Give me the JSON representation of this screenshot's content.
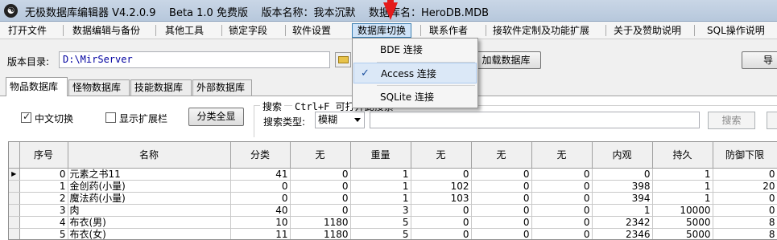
{
  "window": {
    "title": "无极数据库编辑器 V4.2.0.9    Beta 1.0 免费版    版本名称：我本沉默    数据库名：HeroDB.MDB"
  },
  "menu": [
    {
      "id": "open-file",
      "label": "打开文件"
    },
    {
      "id": "db-edit",
      "label": "数据编辑与备份"
    },
    {
      "id": "other-tools",
      "label": "其他工具"
    },
    {
      "id": "lock-field",
      "label": "锁定字段"
    },
    {
      "id": "settings",
      "label": "软件设置"
    },
    {
      "id": "db-switch",
      "label": "数据库切换"
    },
    {
      "id": "contact",
      "label": "联系作者"
    },
    {
      "id": "custom",
      "label": "接软件定制及功能扩展"
    },
    {
      "id": "about",
      "label": "关于及赞助说明"
    },
    {
      "id": "sql",
      "label": "SQL操作说明"
    }
  ],
  "dropdown": {
    "items": [
      {
        "label": "BDE 连接",
        "checked": false
      },
      {
        "label": "Access 连接",
        "checked": true
      },
      {
        "label": "SQLite 连接",
        "checked": false
      }
    ],
    "check_glyph": "✓"
  },
  "dir": {
    "label": "版本目录:",
    "value": "D:\\MirServer",
    "load_button": "加载数据库",
    "import_button": "导入"
  },
  "tabs": [
    {
      "label": "物品数据库",
      "active": true
    },
    {
      "label": "怪物数据库",
      "active": false
    },
    {
      "label": "技能数据库",
      "active": false
    },
    {
      "label": "外部数据库",
      "active": false
    }
  ],
  "options": {
    "chinese_switch": {
      "label": "中文切换",
      "checked": true
    },
    "show_ext": {
      "label": "显示扩展栏",
      "checked": false
    },
    "expand_all": "分类全显"
  },
  "search": {
    "group_title": "搜索",
    "hint": "Ctrl+F 可打开此搜索",
    "type_label": "搜索类型:",
    "type_value": "模糊",
    "button": "搜索"
  },
  "table": {
    "columns": [
      "序号",
      "名称",
      "分类",
      "无",
      "重量",
      "无",
      "无",
      "无",
      "内观",
      "持久",
      "防御下限"
    ],
    "rows": [
      [
        "0",
        "元素之书11",
        "41",
        "0",
        "1",
        "0",
        "0",
        "0",
        "0",
        "1",
        "0"
      ],
      [
        "1",
        "金创药(小量)",
        "0",
        "0",
        "1",
        "102",
        "0",
        "0",
        "398",
        "1",
        "20"
      ],
      [
        "2",
        "魔法药(小量)",
        "0",
        "0",
        "1",
        "103",
        "0",
        "0",
        "394",
        "1",
        "0"
      ],
      [
        "3",
        "肉",
        "40",
        "0",
        "3",
        "0",
        "0",
        "0",
        "1",
        "10000",
        "0"
      ],
      [
        "4",
        "布衣(男)",
        "10",
        "1180",
        "5",
        "0",
        "0",
        "0",
        "2342",
        "5000",
        "8"
      ],
      [
        "5",
        "布衣(女)",
        "11",
        "1180",
        "5",
        "0",
        "0",
        "0",
        "2346",
        "5000",
        "8"
      ]
    ],
    "current_row_marker": "▶"
  }
}
